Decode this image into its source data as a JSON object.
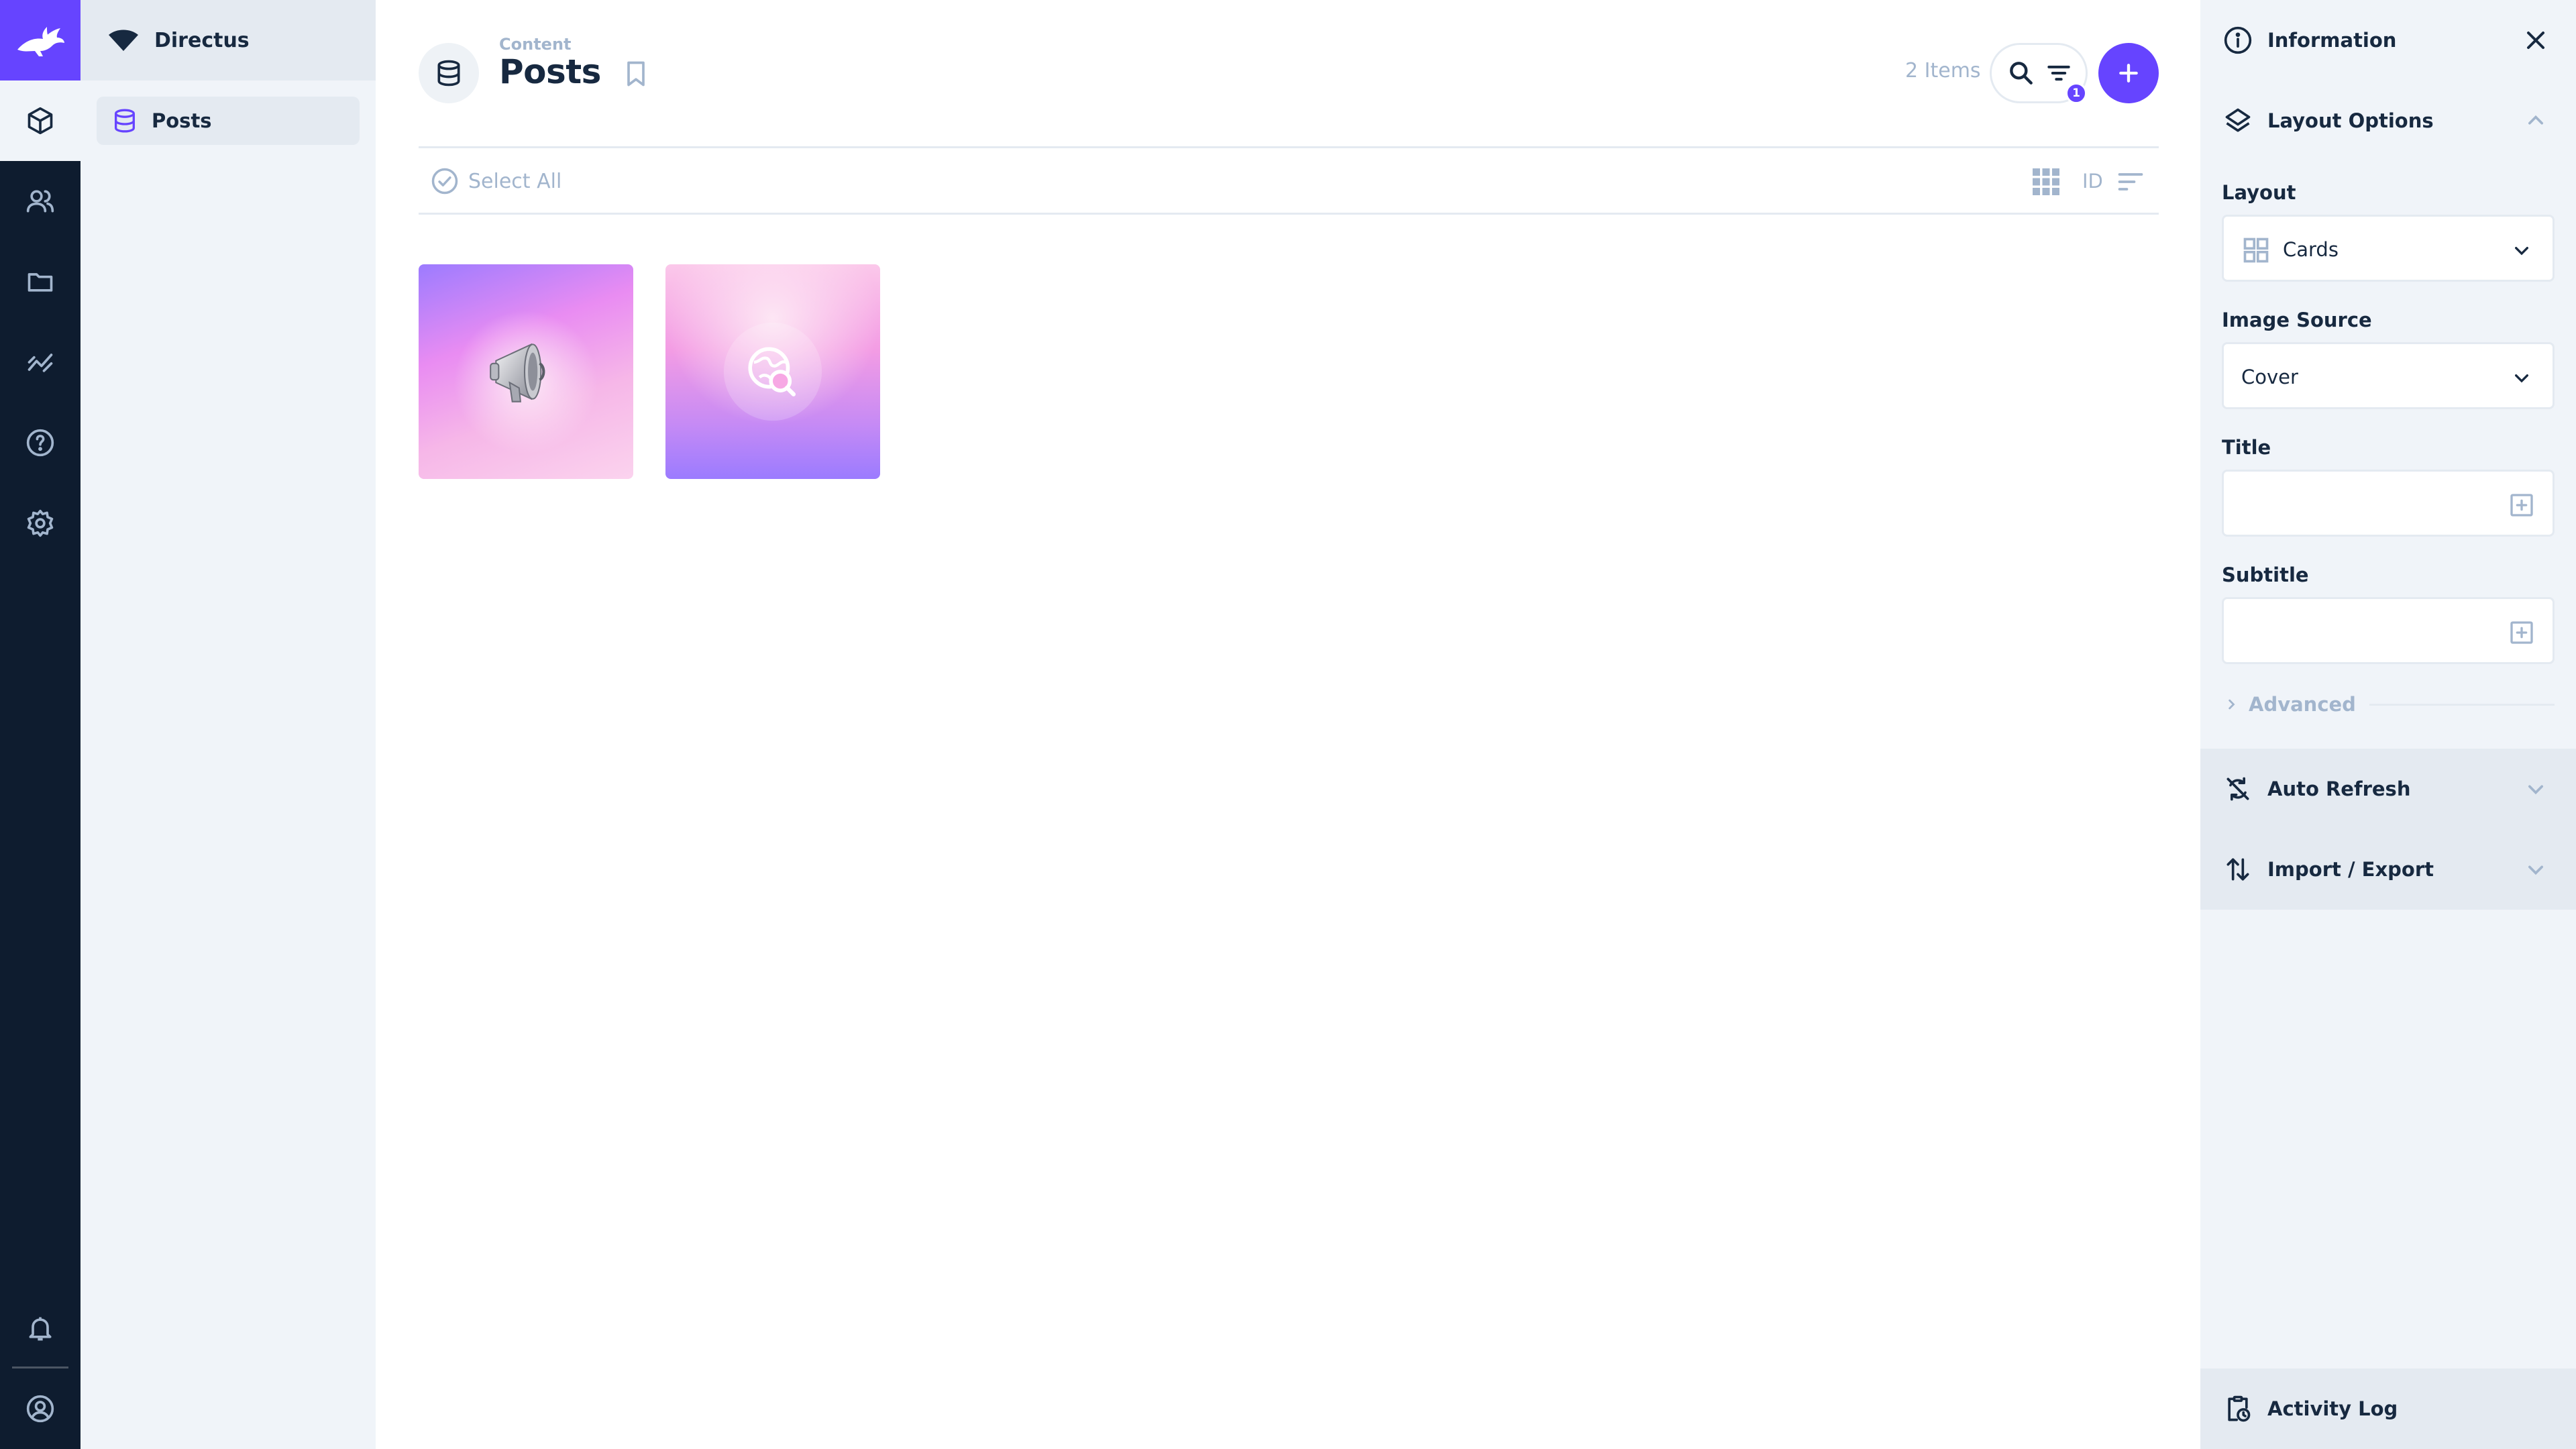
{
  "app": {
    "project_name": "Directus",
    "brand_color": "#6644ff",
    "sidebar_bg": "#0e1c2f"
  },
  "module_bar": {
    "items": [
      "content-icon",
      "users-icon",
      "files-icon",
      "insights-icon",
      "help-icon",
      "settings-icon"
    ],
    "active": "content-icon",
    "bottom": [
      "notifications-icon",
      "user-account-icon"
    ]
  },
  "navigation": {
    "items": [
      {
        "label": "Posts",
        "icon": "database-icon",
        "active": true
      }
    ]
  },
  "header": {
    "breadcrumb": "Content",
    "title": "Posts",
    "item_count": "2 Items",
    "filter_count": "1"
  },
  "toolbar": {
    "select_all": "Select All",
    "sort_field": "ID"
  },
  "cards": [
    {
      "image": "megaphone",
      "colors": [
        "#9c7bff",
        "#f6b7e8"
      ]
    },
    {
      "image": "globe-search",
      "colors": [
        "#fbc8ea",
        "#9b7bff"
      ]
    }
  ],
  "sidebar": {
    "information": "Information",
    "layout_options": "Layout Options",
    "layout_label": "Layout",
    "layout_value": "Cards",
    "image_source_label": "Image Source",
    "image_source_value": "Cover",
    "title_label": "Title",
    "title_value": "",
    "subtitle_label": "Subtitle",
    "subtitle_value": "",
    "advanced": "Advanced",
    "auto_refresh": "Auto Refresh",
    "import_export": "Import / Export",
    "activity_log": "Activity Log"
  }
}
